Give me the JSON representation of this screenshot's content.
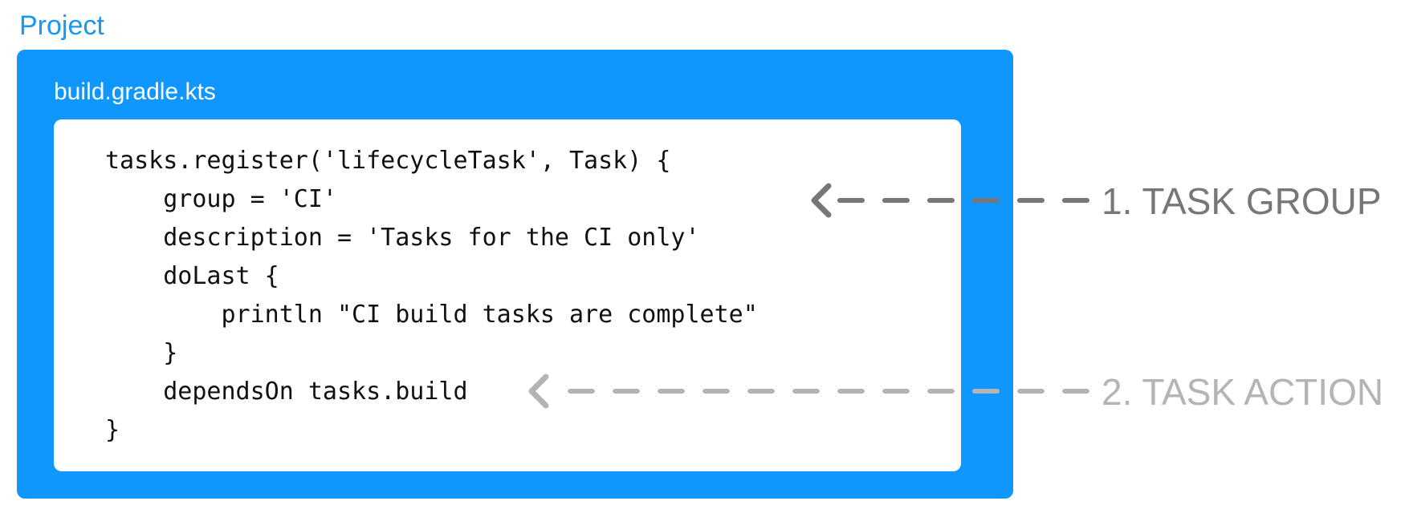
{
  "project": {
    "label": "Project",
    "color": "#1097fd"
  },
  "file": {
    "name": "build.gradle.kts"
  },
  "code_lines": [
    "tasks.register('lifecycleTask', Task) {",
    "    group = 'CI'",
    "    description = 'Tasks for the CI only'",
    "    doLast {",
    "        println \"CI build tasks are complete\"",
    "    }",
    "    dependsOn tasks.build",
    "}"
  ],
  "callouts": [
    {
      "text": "1. TASK GROUP",
      "color": "#777777"
    },
    {
      "text": "2. TASK ACTION",
      "color": "#b4b4b4"
    }
  ]
}
